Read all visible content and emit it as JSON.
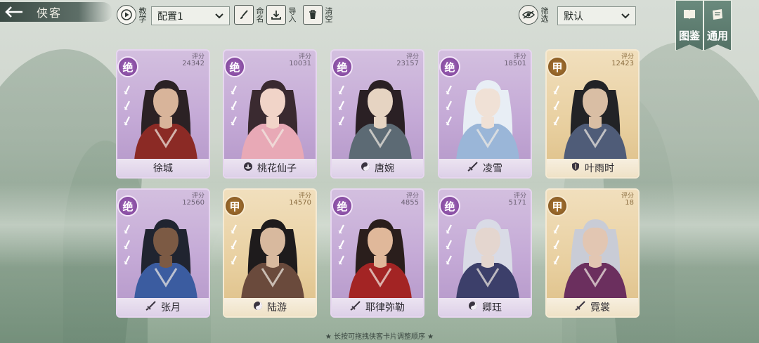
{
  "header": {
    "title": "侠客",
    "tutorial_label": "教学",
    "config_select": "配置1",
    "rename_label": "命名",
    "import_label": "导入",
    "clear_label": "清空",
    "filter_label": "筛选",
    "sort_select": "默认",
    "atlas_label": "图鉴",
    "common_label": "通用"
  },
  "score_label": "评分",
  "cards": [
    {
      "rank": "绝",
      "tier": "jue",
      "score": "24342",
      "name": "徐城",
      "school_icon": "",
      "palette": [
        "#8b2a25",
        "#2b2124",
        "#d8b49a"
      ]
    },
    {
      "rank": "绝",
      "tier": "jue",
      "score": "10031",
      "name": "桃花仙子",
      "school_icon": "lotus-icon",
      "palette": [
        "#e8a9b6",
        "#3a2a30",
        "#f1d4c8"
      ]
    },
    {
      "rank": "绝",
      "tier": "jue",
      "score": "23157",
      "name": "唐婉",
      "school_icon": "yinyang-icon",
      "palette": [
        "#5c6a74",
        "#2a2024",
        "#e6d4c2"
      ]
    },
    {
      "rank": "绝",
      "tier": "jue",
      "score": "18501",
      "name": "凌雪",
      "school_icon": "sword-icon",
      "palette": [
        "#9ab6d8",
        "#e8eef5",
        "#f0e1d6"
      ]
    },
    {
      "rank": "甲",
      "tier": "jia",
      "score": "12423",
      "name": "叶雨时",
      "school_icon": "shield-icon",
      "palette": [
        "#4f5c78",
        "#222326",
        "#d9bea4"
      ]
    },
    {
      "rank": "绝",
      "tier": "jue",
      "score": "12560",
      "name": "张月",
      "school_icon": "sword-icon",
      "palette": [
        "#3b5ca0",
        "#202430",
        "#7c5a44"
      ]
    },
    {
      "rank": "甲",
      "tier": "jia",
      "score": "14570",
      "name": "陆游",
      "school_icon": "yinyang-icon",
      "palette": [
        "#6a4a3c",
        "#1e1b1c",
        "#d8b99e"
      ]
    },
    {
      "rank": "绝",
      "tier": "jue",
      "score": "4855",
      "name": "耶律弥勒",
      "school_icon": "sword-icon",
      "palette": [
        "#a32424",
        "#2a1e1c",
        "#e0b89a"
      ]
    },
    {
      "rank": "绝",
      "tier": "jue",
      "score": "5171",
      "name": "卿珏",
      "school_icon": "yinyang-icon",
      "palette": [
        "#3c3f6a",
        "#d9dbe6",
        "#e4d6cf"
      ]
    },
    {
      "rank": "甲",
      "tier": "jia",
      "score": "18",
      "name": "霓裳",
      "school_icon": "sword-icon",
      "palette": [
        "#6b2f5e",
        "#c9ccd6",
        "#e2c6b2"
      ]
    }
  ],
  "footer_hint": "★ 长按可拖拽侠客卡片调整顺序 ★"
}
